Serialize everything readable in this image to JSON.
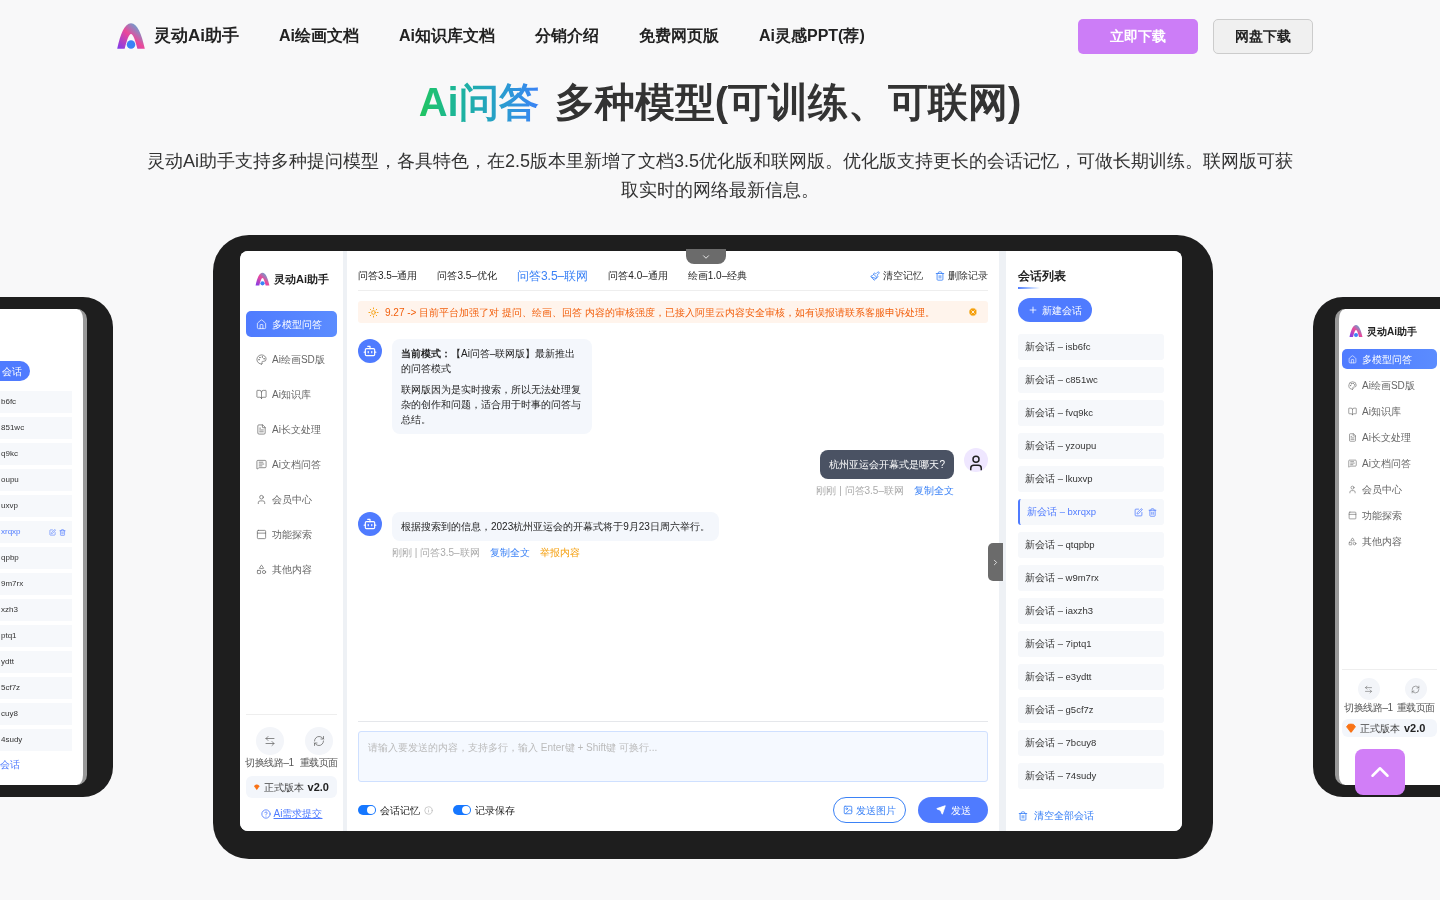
{
  "header": {
    "logo": "灵动Ai助手",
    "nav": [
      "Ai绘画文档",
      "Ai知识库文档",
      "分销介绍",
      "免费网页版",
      "Ai灵感PPT(荐)"
    ],
    "buttons": [
      {
        "label": "立即下载",
        "kind": "primary"
      },
      {
        "label": "网盘下载",
        "kind": "secondary"
      }
    ]
  },
  "hero": {
    "title_highlight": "Ai问答",
    "title": "多种模型(可训练、可联网)",
    "description": "灵动Ai助手支持多种提问模型，各具特色，在2.5版本里新增了文档3.5优化版和联网版。优化版支持更长的会话记忆，可做长期训练。联网版可获取实时的网络最新信息。"
  },
  "left_preview": {
    "new_fragment": "会话",
    "items": [
      {
        "label": "b6fc",
        "selected": false
      },
      {
        "label": "851wc",
        "selected": false
      },
      {
        "label": "q9kc",
        "selected": false
      },
      {
        "label": "oupu",
        "selected": false
      },
      {
        "label": "uxvp",
        "selected": false
      },
      {
        "label": "xrqxp",
        "selected": true
      },
      {
        "label": "qpbp",
        "selected": false
      },
      {
        "label": "9m7rx",
        "selected": false
      },
      {
        "label": "xzh3",
        "selected": false
      },
      {
        "label": "ptq1",
        "selected": false
      },
      {
        "label": "ydtt",
        "selected": false
      },
      {
        "label": "5cf7z",
        "selected": false
      },
      {
        "label": "cuy8",
        "selected": false
      },
      {
        "label": "4sudy",
        "selected": false
      }
    ],
    "clear_fragment": "会话"
  },
  "app": {
    "logo": "灵动Ai助手",
    "sidebar": [
      {
        "label": "多模型问答",
        "selected": true
      },
      {
        "label": "Ai绘画SD版",
        "selected": false
      },
      {
        "label": "Ai知识库",
        "selected": false
      },
      {
        "label": "Ai长文处理",
        "selected": false
      },
      {
        "label": "Ai文档问答",
        "selected": false
      },
      {
        "label": "会员中心",
        "selected": false
      },
      {
        "label": "功能探索",
        "selected": false
      },
      {
        "label": "其他内容",
        "selected": false
      }
    ],
    "tools": [
      "切换线路–1",
      "重载页面"
    ],
    "version": {
      "label": "正式版本",
      "value": "v2.0"
    },
    "feedback_link": "Ai需求提交",
    "model_tabs": [
      {
        "label": "问答3.5–通用",
        "selected": false
      },
      {
        "label": "问答3.5–优化",
        "selected": false
      },
      {
        "label": "问答3.5–联网",
        "selected": true
      },
      {
        "label": "问答4.0–通用",
        "selected": false
      },
      {
        "label": "绘画1.0–经典",
        "selected": false
      }
    ],
    "actions": [
      "清空记忆",
      "删除记录"
    ],
    "notice": "9.27 -> 目前平台加强了对 提问、绘画、回答 内容的审核强度，已接入阿里云内容安全审核，如有误报请联系客服申诉处理。",
    "messages": [
      {
        "kind": "bot",
        "paragraphs": [
          "**当前模式：**【Ai问答–联网版】最新推出的问答模式",
          "联网版因为是实时搜索，所以无法处理复杂的创作和问题，适合用于时事的问答与总结。"
        ]
      },
      {
        "kind": "user",
        "paragraphs": [
          "杭州亚运会开幕式是哪天?"
        ],
        "meta": "刚刚 | 问答3.5–联网",
        "links": [
          {
            "label": "复制全文",
            "kind": "copy"
          }
        ]
      },
      {
        "kind": "bot",
        "paragraphs": [
          "根据搜索到的信息，2023杭州亚运会的开幕式将于9月23日周六举行。"
        ],
        "meta": "刚刚 | 问答3.5–联网",
        "links": [
          {
            "label": "复制全文",
            "kind": "copy"
          },
          {
            "label": "举报内容",
            "kind": "report"
          }
        ]
      }
    ],
    "input": {
      "placeholder": "请输入要发送的内容，支持多行，输入 Enter键 + Shift键 可换行..."
    },
    "toggles": [
      {
        "label": "会话记忆",
        "on": true,
        "info": true
      },
      {
        "label": "记录保存",
        "on": true,
        "info": false
      }
    ],
    "send_image": "发送图片",
    "send": "发送",
    "sessions": {
      "title": "会话列表",
      "new": "新建会话",
      "items": [
        {
          "label": "新会话 – isb6fc",
          "selected": false
        },
        {
          "label": "新会话 – c851wc",
          "selected": false
        },
        {
          "label": "新会话 – fvq9kc",
          "selected": false
        },
        {
          "label": "新会话 – yzoupu",
          "selected": false
        },
        {
          "label": "新会话 – lkuxvp",
          "selected": false
        },
        {
          "label": "新会话 – bxrqxp",
          "selected": true
        },
        {
          "label": "新会话 – qtqpbp",
          "selected": false
        },
        {
          "label": "新会话 – w9m7rx",
          "selected": false
        },
        {
          "label": "新会话 – iaxzh3",
          "selected": false
        },
        {
          "label": "新会话 – 7iptq1",
          "selected": false
        },
        {
          "label": "新会话 – e3ydtt",
          "selected": false
        },
        {
          "label": "新会话 – g5cf7z",
          "selected": false
        },
        {
          "label": "新会话 – 7bcuy8",
          "selected": false
        },
        {
          "label": "新会话 – 74sudy",
          "selected": false
        }
      ],
      "clear": "清空全部会话"
    }
  },
  "right_preview": {
    "logo": "灵动Ai助手",
    "sidebar": [
      {
        "label": "多模型问答",
        "selected": true
      },
      {
        "label": "Ai绘画SD版",
        "selected": false
      },
      {
        "label": "Ai知识库",
        "selected": false
      },
      {
        "label": "Ai长文处理",
        "selected": false
      },
      {
        "label": "Ai文档问答",
        "selected": false
      },
      {
        "label": "会员中心",
        "selected": false
      },
      {
        "label": "功能探索",
        "selected": false
      },
      {
        "label": "其他内容",
        "selected": false
      }
    ],
    "tools": [
      "切换线路–1",
      "重载页面"
    ],
    "version": {
      "label": "正式版本",
      "value": "v2.0"
    }
  }
}
